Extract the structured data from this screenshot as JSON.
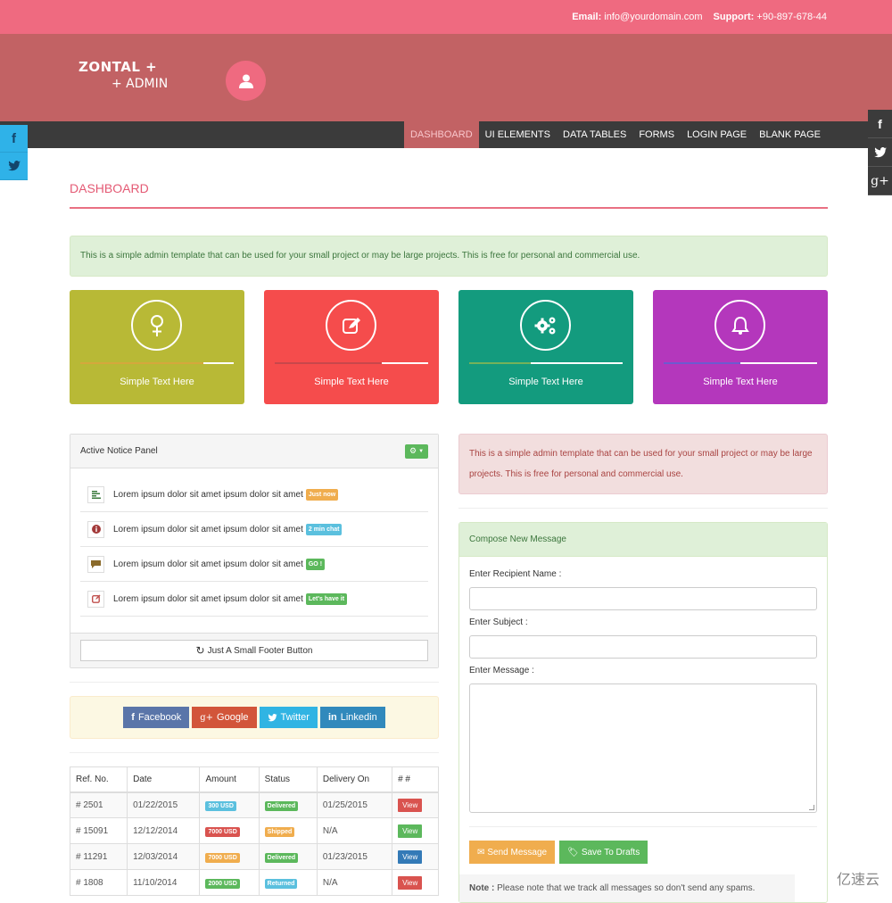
{
  "topbar": {
    "email_label": "Email:",
    "email_value": "info@yourdomain.com",
    "support_label": "Support:",
    "support_value": "+90-897-678-44"
  },
  "brand": {
    "line1": "ZONTAL +",
    "line2": "+ ADMIN"
  },
  "nav": {
    "items": [
      {
        "label": "DASHBOARD",
        "active": true
      },
      {
        "label": "UI ELEMENTS"
      },
      {
        "label": "DATA TABLES"
      },
      {
        "label": "FORMS"
      },
      {
        "label": "LOGIN PAGE"
      },
      {
        "label": "BLANK PAGE"
      }
    ]
  },
  "social_left": [
    "facebook-icon",
    "twitter-icon"
  ],
  "social_right": [
    "facebook-icon",
    "twitter-icon",
    "google-plus-icon"
  ],
  "page_title": "DASHBOARD",
  "success_alert": "This is a simple admin template that can be used for your small project or may be large projects. This is free for personal and commercial use.",
  "cards": [
    {
      "icon": "female-icon",
      "text": "Simple Text Here",
      "color": "#b8b936",
      "progress": 0.8,
      "fill_color": "#d5a83c"
    },
    {
      "icon": "edit-icon",
      "text": "Simple Text Here",
      "color": "#f54c4c",
      "progress": 0.7,
      "fill_color": "#c8474b"
    },
    {
      "icon": "gears-icon",
      "text": "Simple Text Here",
      "color": "#139b7e",
      "progress": 0.4,
      "fill_color": "#74b25a"
    },
    {
      "icon": "bell-icon",
      "text": "Simple Text Here",
      "color": "#b437bc",
      "progress": 0.5,
      "fill_color": "#6d5ad0"
    }
  ],
  "notice_panel": {
    "title": "Active Notice Panel",
    "items": [
      {
        "icon": "align-left-icon",
        "text": "Lorem ipsum dolor sit amet ipsum dolor sit amet",
        "badge": "Just now",
        "badge_color": "#f0ad4e"
      },
      {
        "icon": "info-circle-icon",
        "text": "Lorem ipsum dolor sit amet ipsum dolor sit amet",
        "badge": "2 min chat",
        "badge_color": "#5bc0de"
      },
      {
        "icon": "comment-icon",
        "text": "Lorem ipsum dolor sit amet ipsum dolor sit amet",
        "badge": "GO !",
        "badge_color": "#5cb85c"
      },
      {
        "icon": "edit-icon",
        "text": "Lorem ipsum dolor sit amet ipsum dolor sit amet",
        "badge": "Let's have it",
        "badge_color": "#5cb85c"
      }
    ],
    "footer_button": "Just A Small Footer Button"
  },
  "social_buttons": [
    {
      "label": "Facebook",
      "icon": "facebook-icon",
      "color": "#5a75a9"
    },
    {
      "label": "Google",
      "icon": "google-plus-icon",
      "color": "#d2553a"
    },
    {
      "label": "Twitter",
      "icon": "twitter-icon",
      "color": "#30b4e3"
    },
    {
      "label": "Linkedin",
      "icon": "linkedin-icon",
      "color": "#3189bc"
    }
  ],
  "orders_table": {
    "headers": [
      "Ref. No.",
      "Date",
      "Amount",
      "Status",
      "Delivery On",
      "# #"
    ],
    "rows": [
      {
        "ref": "# 2501",
        "date": "01/22/2015",
        "amount": "300 USD",
        "amount_color": "#5bc0de",
        "status": "Delivered",
        "status_color": "#5cb85c",
        "delivery": "01/25/2015",
        "action": "View",
        "action_color": "#d9534f"
      },
      {
        "ref": "# 15091",
        "date": "12/12/2014",
        "amount": "7000 USD",
        "amount_color": "#d9534f",
        "status": "Shipped",
        "status_color": "#f0ad4e",
        "delivery": "N/A",
        "action": "View",
        "action_color": "#5cb85c"
      },
      {
        "ref": "# 11291",
        "date": "12/03/2014",
        "amount": "7000 USD",
        "amount_color": "#f0ad4e",
        "status": "Delivered",
        "status_color": "#5cb85c",
        "delivery": "01/23/2015",
        "action": "View",
        "action_color": "#337ab7"
      },
      {
        "ref": "# 1808",
        "date": "11/10/2014",
        "amount": "2000 USD",
        "amount_color": "#5cb85c",
        "status": "Returned",
        "status_color": "#5bc0de",
        "delivery": "N/A",
        "action": "View",
        "action_color": "#d9534f"
      }
    ]
  },
  "danger_alert": "This is a simple admin template that can be used for your small project or may be large projects. This is free for personal and commercial use.",
  "compose": {
    "title": "Compose New Message",
    "recipient_label": "Enter Recipient Name :",
    "recipient_value": "",
    "subject_label": "Enter Subject :",
    "subject_value": "",
    "message_label": "Enter Message :",
    "message_value": "",
    "send_label": "Send Message",
    "drafts_label": "Save To Drafts",
    "note_label": "Note :",
    "note_text": "Please note that we track all messages so don't send any spams."
  },
  "watermark": "亿速云"
}
